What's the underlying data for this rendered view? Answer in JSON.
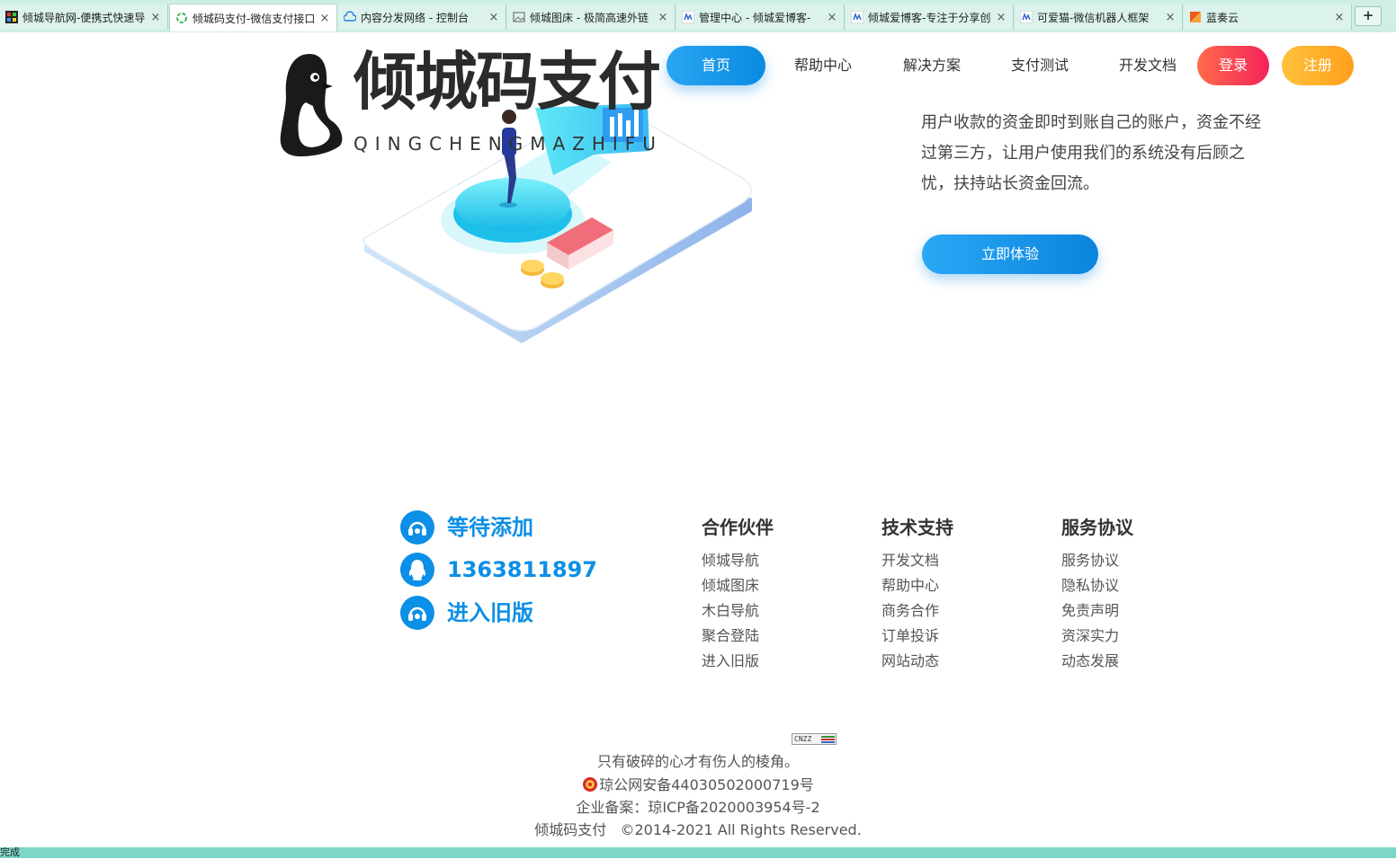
{
  "browser": {
    "tabs": [
      {
        "title": "倾城导航网-便携式快速导",
        "active": false,
        "icon": "grid-favicon"
      },
      {
        "title": "倾城码支付-微信支付接口",
        "active": true,
        "icon": "loading-favicon"
      },
      {
        "title": "内容分发网络 - 控制台",
        "active": false,
        "icon": "cloud-favicon"
      },
      {
        "title": "倾城图床 - 极简高速外链",
        "active": false,
        "icon": "image-favicon"
      },
      {
        "title": "管理中心 - 倾城爱博客-",
        "active": false,
        "icon": "blog-favicon"
      },
      {
        "title": "倾城爱博客-专注于分享创",
        "active": false,
        "icon": "blog-favicon"
      },
      {
        "title": "可爱猫-微信机器人框架",
        "active": false,
        "icon": "blog-favicon"
      },
      {
        "title": "蓝奏云",
        "active": false,
        "icon": "lanzou-favicon"
      }
    ],
    "new_tab_label": "+",
    "close_label": "×",
    "status_text": "完成"
  },
  "header": {
    "logo_text": "倾城码支付",
    "logo_sub": "QINGCHENGMAZHIFU",
    "nav": {
      "home": "首页",
      "help": "帮助中心",
      "solutions": "解决方案",
      "pay_test": "支付测试",
      "dev_docs": "开发文档",
      "login": "登录",
      "register": "注册"
    }
  },
  "hero": {
    "description": "用户收款的资金即时到账自己的账户，资金不经过第三方，让用户使用我们的系统没有后顾之忧，扶持站长资金回流。",
    "cta": "立即体验"
  },
  "footer": {
    "contacts": [
      {
        "text": "等待添加",
        "icon": "headset-icon"
      },
      {
        "text": "1363811897",
        "icon": "qq-icon"
      },
      {
        "text": "进入旧版",
        "icon": "headset-icon"
      }
    ],
    "columns": [
      {
        "title": "合作伙伴",
        "links": [
          "倾城导航",
          "倾城图床",
          "木白导航",
          "聚合登陆",
          "进入旧版"
        ]
      },
      {
        "title": "技术支持",
        "links": [
          "开发文档",
          "帮助中心",
          "商务合作",
          "订单投诉",
          "网站动态"
        ]
      },
      {
        "title": "服务协议",
        "links": [
          "服务协议",
          "隐私协议",
          "免责声明",
          "资深实力",
          "动态发展"
        ]
      }
    ],
    "cnzz_label": "CNZZ",
    "motto": "只有破碎的心才有伤人的棱角。",
    "police_record": "琼公网安备44030502000719号",
    "icp_record": "企业备案：琼ICP备2020003954号-2",
    "copyright": "倾城码支付   ©2014-2021 All Rights Reserved."
  },
  "colors": {
    "brand_blue": "#0c8fe6",
    "login_red": "#f5225a",
    "register_orange": "#ff9f1c",
    "tabbar_bg": "#cfeee6"
  }
}
